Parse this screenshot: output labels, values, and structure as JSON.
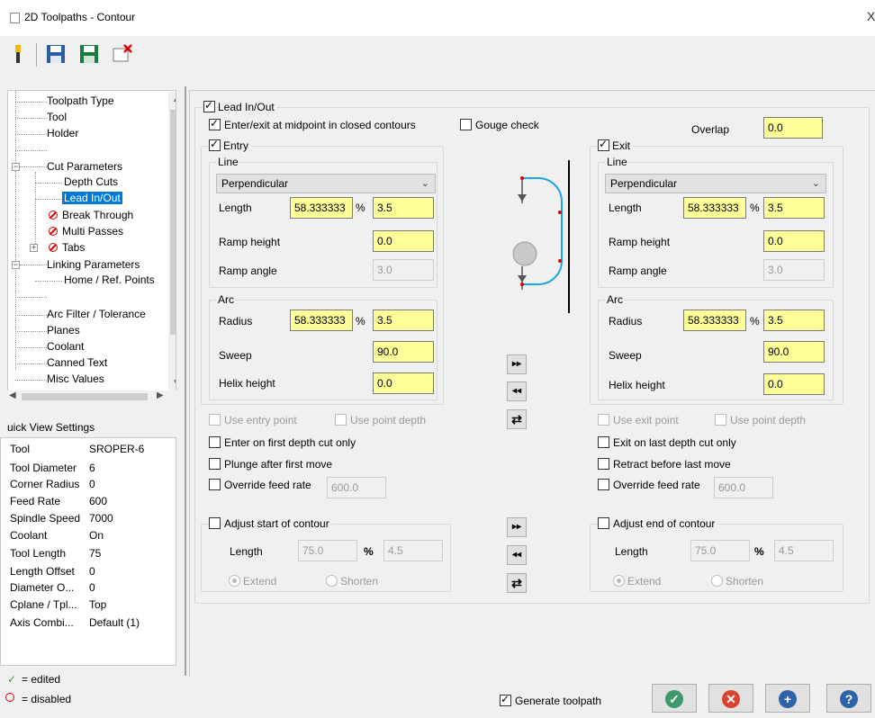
{
  "window": {
    "title": "2D Toolpaths - Contour",
    "close_label": "X"
  },
  "toolbar": {
    "icons": [
      "tool-icon",
      "save-icon",
      "save-as-icon",
      "delete-icon"
    ]
  },
  "tree": {
    "items": [
      {
        "label": "Toolpath Type"
      },
      {
        "label": "Tool"
      },
      {
        "label": "Holder"
      },
      {
        "label": "Cut Parameters"
      },
      {
        "label": "Depth Cuts"
      },
      {
        "label": "Lead In/Out"
      },
      {
        "label": "Break Through"
      },
      {
        "label": "Multi Passes"
      },
      {
        "label": "Tabs"
      },
      {
        "label": "Linking Parameters"
      },
      {
        "label": "Home / Ref. Points"
      },
      {
        "label": "Arc Filter / Tolerance"
      },
      {
        "label": "Planes"
      },
      {
        "label": "Coolant"
      },
      {
        "label": "Canned Text"
      },
      {
        "label": "Misc Values"
      }
    ]
  },
  "quick_view": {
    "title": "uick View Settings",
    "rows": [
      {
        "label": "Tool",
        "value": "SROPER-6"
      },
      {
        "label": "Tool Diameter",
        "value": "6"
      },
      {
        "label": "Corner Radius",
        "value": "0"
      },
      {
        "label": "Feed Rate",
        "value": "600"
      },
      {
        "label": "Spindle Speed",
        "value": "7000"
      },
      {
        "label": "Coolant",
        "value": "On"
      },
      {
        "label": "Tool Length",
        "value": "75"
      },
      {
        "label": "Length Offset",
        "value": "0"
      },
      {
        "label": "Diameter O...",
        "value": "0"
      },
      {
        "label": "Cplane / Tpl...",
        "value": "Top"
      },
      {
        "label": "Axis Combi...",
        "value": "Default (1)"
      }
    ]
  },
  "legend": {
    "edited": "= edited",
    "disabled": "= disabled"
  },
  "lead": {
    "title": "Lead In/Out",
    "midpoint_label": "Enter/exit at midpoint in closed contours",
    "gouge_label": "Gouge check",
    "overlap_label": "Overlap",
    "overlap_value": "0.0"
  },
  "entry": {
    "title": "Entry",
    "line_title": "Line",
    "line_type": "Perpendicular",
    "length_label": "Length",
    "length_pct": "58.333333",
    "pct_symbol": "%",
    "length_value": "3.5",
    "ramp_height_label": "Ramp height",
    "ramp_height": "0.0",
    "ramp_angle_label": "Ramp angle",
    "ramp_angle": "3.0",
    "arc_title": "Arc",
    "radius_label": "Radius",
    "radius_pct": "58.333333",
    "radius_value": "3.5",
    "sweep_label": "Sweep",
    "sweep": "90.0",
    "helix_label": "Helix height",
    "helix": "0.0",
    "use_point_label": "Use entry point",
    "use_depth_label": "Use point depth",
    "first_depth_label": "Enter on first depth cut only",
    "plunge_label": "Plunge after first move",
    "override_label": "Override feed rate",
    "override_value": "600.0"
  },
  "exit": {
    "title": "Exit",
    "line_title": "Line",
    "line_type": "Perpendicular",
    "length_label": "Length",
    "length_pct": "58.333333",
    "pct_symbol": "%",
    "length_value": "3.5",
    "ramp_height_label": "Ramp height",
    "ramp_height": "0.0",
    "ramp_angle_label": "Ramp angle",
    "ramp_angle": "3.0",
    "arc_title": "Arc",
    "radius_label": "Radius",
    "radius_pct": "58.333333",
    "radius_value": "3.5",
    "sweep_label": "Sweep",
    "sweep": "90.0",
    "helix_label": "Helix height",
    "helix": "0.0",
    "use_point_label": "Use exit point",
    "use_depth_label": "Use point depth",
    "last_depth_label": "Exit on last depth cut only",
    "retract_label": "Retract before last move",
    "override_label": "Override feed rate",
    "override_value": "600.0"
  },
  "adjust_start": {
    "title": "Adjust start of contour",
    "length_label": "Length",
    "length_value": "75.0",
    "pct_symbol": "%",
    "pct_value": "4.5",
    "extend_label": "Extend",
    "shorten_label": "Shorten"
  },
  "adjust_end": {
    "title": "Adjust end of contour",
    "length_label": "Length",
    "length_value": "75.0",
    "pct_symbol": "%",
    "pct_value": "4.5",
    "extend_label": "Extend",
    "shorten_label": "Shorten"
  },
  "footer": {
    "generate_label": "Generate toolpath"
  },
  "colors": {
    "ok": "#3c9a6b",
    "cancel": "#d9432f",
    "add": "#2e63a8",
    "help": "#2e63a8",
    "field": "#ffff99"
  }
}
